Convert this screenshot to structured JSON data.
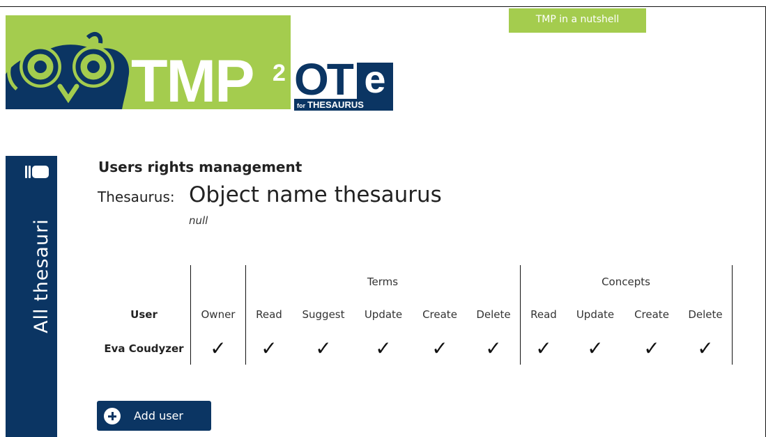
{
  "header": {
    "logo_tmp": "TMP",
    "logo_sup": "2",
    "logo_ote": "OT",
    "logo_ote_e": "e",
    "logo_sub_for": "for",
    "logo_sub_name": "THESAURUS",
    "nutshell_button": "TMP in a nutshell",
    "colors": {
      "green": "#a4cc4e",
      "navy": "#0b3563"
    }
  },
  "sidebar": {
    "label": "All thesauri",
    "icon": "books-icon"
  },
  "page": {
    "title": "Users rights management",
    "thesaurus_label": "Thesaurus:",
    "thesaurus_name": "Object name thesaurus",
    "thesaurus_subtitle": "null"
  },
  "rights_table": {
    "groups": [
      "Terms",
      "Concepts"
    ],
    "columns": {
      "user": "User",
      "owner": "Owner",
      "terms": [
        "Read",
        "Suggest",
        "Update",
        "Create",
        "Delete"
      ],
      "concepts": [
        "Read",
        "Update",
        "Create",
        "Delete"
      ]
    },
    "rows": [
      {
        "user": "Eva Coudyzer",
        "owner": true,
        "terms": [
          true,
          true,
          true,
          true,
          true
        ],
        "concepts": [
          true,
          true,
          true,
          true
        ],
        "check_glyph": "✓"
      }
    ]
  },
  "actions": {
    "add_user": "Add user",
    "add_icon": "plus-circle-icon"
  }
}
